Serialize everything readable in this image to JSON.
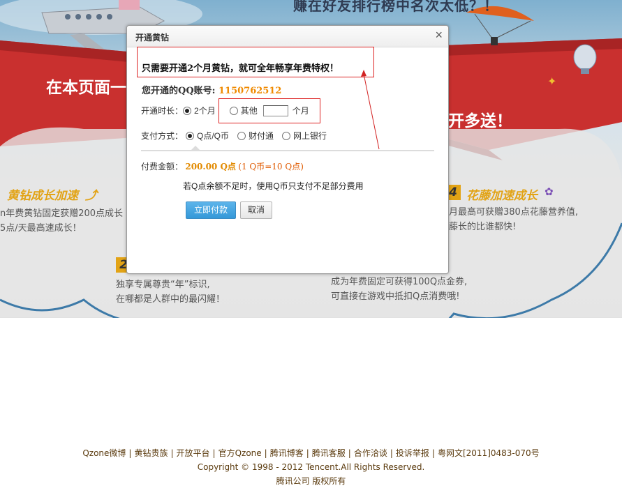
{
  "promo": {
    "headline": "赚在好友排行榜中名次太低？！",
    "banner_left": "在本页面一",
    "banner_right": "开多送！",
    "features": [
      {
        "num": "",
        "title": "黄钻成长加速",
        "lines": [
          "n年费黄钻固定获赠200点成长",
          "5点/天最高速成长！"
        ]
      },
      {
        "num": "4",
        "title": "花藤加速成长",
        "lines": [
          "月最高可获赠380点花藤营养值,",
          "藤长的比谁都快!"
        ]
      },
      {
        "num": "2",
        "title": "",
        "lines": [
          "独享专属尊贵“年”标识,",
          "在哪都是人群中的最闪耀！"
        ]
      },
      {
        "num": "",
        "title": "",
        "lines": [
          "成为年费固定可获得100Q点金券,",
          "可直接在游戏中抵扣Q点消费哦!"
        ]
      }
    ]
  },
  "dialog": {
    "title": "开通黄钻",
    "close_glyph": "×",
    "promo_line": "只需要开通2个月黄钻，就可全年畅享年费特权！",
    "account_label": "您开通的QQ账号:",
    "account_number": "1150762512",
    "duration_label": "开通时长：",
    "duration_option_2": "2个月",
    "duration_option_other": "其他",
    "duration_other_value": "",
    "duration_unit": "个月",
    "payment_label": "支付方式：",
    "payment_options": [
      "Q点/Q币",
      "财付通",
      "网上银行"
    ],
    "amount_label": "付费金额：",
    "amount_value": "200.00 Q点",
    "amount_rate": "(1 Q币=10 Q点)",
    "note": "若Q点余额不足时，使用Q币只支付不足部分费用",
    "pay_button": "立即付款",
    "cancel_button": "取消"
  },
  "footer": {
    "links": [
      "Qzone微博",
      "黄钻贵族",
      "开放平台",
      "官方Qzone",
      "腾讯博客",
      "腾讯客服",
      "合作洽谈",
      "投诉举报",
      "粤网文[2011]0483-070号"
    ],
    "copyright": "Copyright © 1998 - 2012 Tencent.All Rights Reserved.",
    "company": "腾讯公司 版权所有"
  },
  "colors": {
    "banner_red": "#c9302f",
    "accent_orange": "#f08a00",
    "feature_gold": "#e2a315",
    "primary_blue": "#3498d8",
    "annotation_red": "#d22222"
  }
}
